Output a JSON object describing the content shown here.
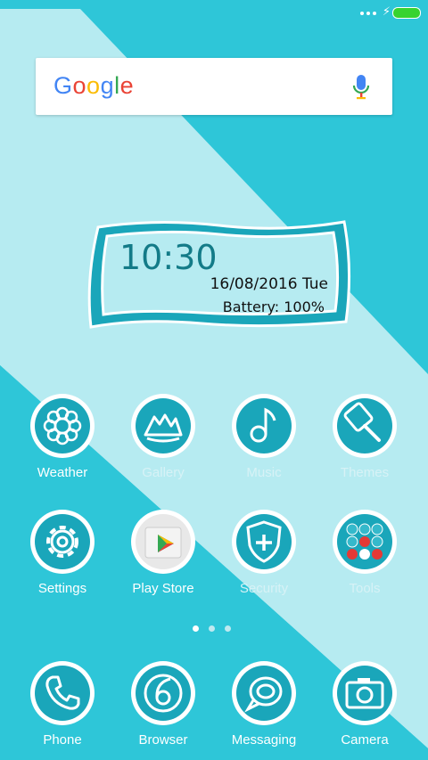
{
  "search": {
    "logo": [
      "G",
      "o",
      "o",
      "g",
      "l",
      "e"
    ]
  },
  "clock": {
    "time": "10:30",
    "date": "16/08/2016 Tue",
    "battery": "Battery: 100%"
  },
  "colors": {
    "accent": "#2ec6d8",
    "light": "#b6ebf1",
    "icon_ring": "#1aa6ba"
  },
  "row1": [
    {
      "label": "Weather",
      "icon": "flower-icon"
    },
    {
      "label": "Gallery",
      "icon": "mountain-icon"
    },
    {
      "label": "Music",
      "icon": "music-note-icon"
    },
    {
      "label": "Themes",
      "icon": "brush-icon"
    }
  ],
  "row2": [
    {
      "label": "Settings",
      "icon": "gear-icon"
    },
    {
      "label": "Play Store",
      "icon": "play-store-icon"
    },
    {
      "label": "Security",
      "icon": "shield-plus-icon"
    },
    {
      "label": "Tools",
      "icon": "folder-icon"
    }
  ],
  "dock": [
    {
      "label": "Phone",
      "icon": "phone-icon"
    },
    {
      "label": "Browser",
      "icon": "browser-icon"
    },
    {
      "label": "Messaging",
      "icon": "chat-bubble-icon"
    },
    {
      "label": "Camera",
      "icon": "camera-icon"
    }
  ],
  "pager": {
    "pages": 3,
    "active": 0
  }
}
